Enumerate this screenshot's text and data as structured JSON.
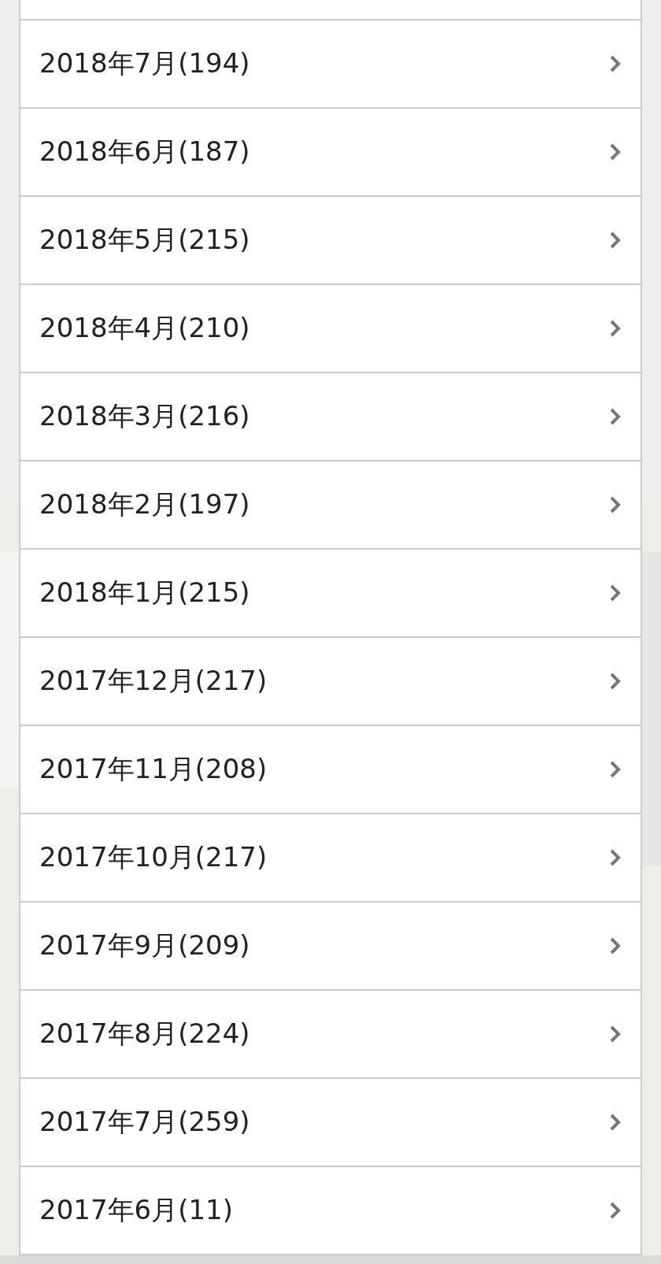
{
  "archive_items": [
    {
      "label": "2018年7月(194)"
    },
    {
      "label": "2018年6月(187)"
    },
    {
      "label": "2018年5月(215)"
    },
    {
      "label": "2018年4月(210)"
    },
    {
      "label": "2018年3月(216)"
    },
    {
      "label": "2018年2月(197)"
    },
    {
      "label": "2018年1月(215)"
    },
    {
      "label": "2017年12月(217)"
    },
    {
      "label": "2017年11月(208)"
    },
    {
      "label": "2017年10月(217)"
    },
    {
      "label": "2017年9月(209)"
    },
    {
      "label": "2017年8月(224)"
    },
    {
      "label": "2017年7月(259)"
    },
    {
      "label": "2017年6月(11)"
    }
  ]
}
